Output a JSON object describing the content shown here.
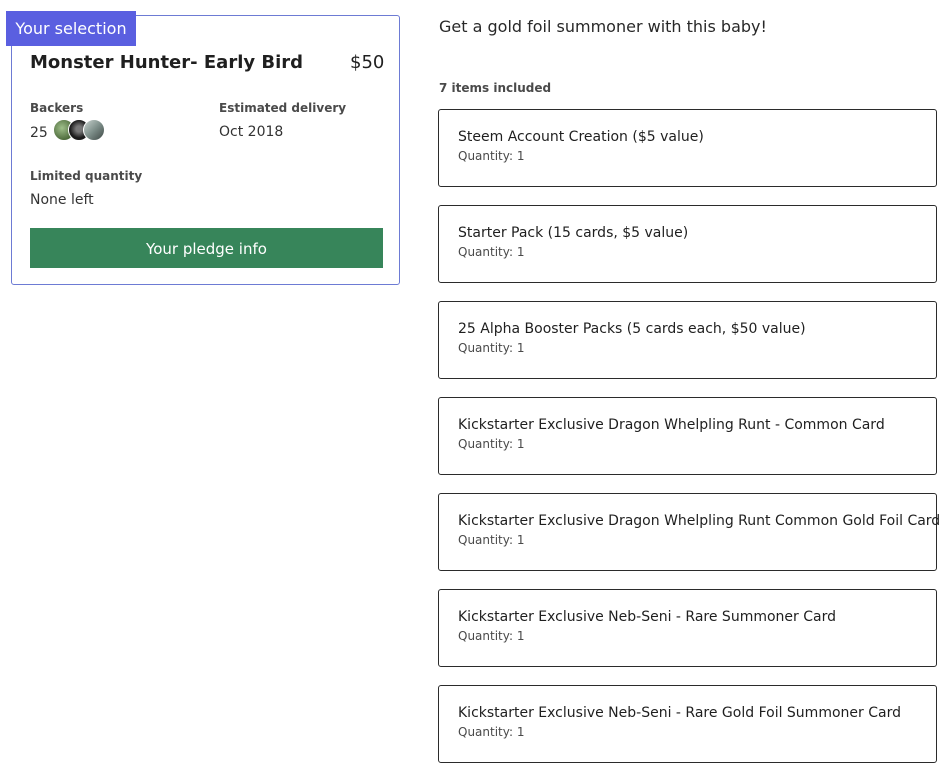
{
  "reward": {
    "badge": "Your selection",
    "title": "Monster Hunter- Early Bird",
    "price": "$50",
    "backers_label": "Backers",
    "backers_count": "25",
    "delivery_label": "Estimated delivery",
    "delivery_value": "Oct 2018",
    "limited_label": "Limited quantity",
    "limited_value": "None left",
    "pledge_button": "Your pledge info",
    "colors": {
      "accent": "#5a5fe0",
      "button": "#37855a",
      "border": "#6d7bd4"
    }
  },
  "details": {
    "description": "Get a gold foil summoner with this baby!",
    "items_count": "7 items included",
    "items": [
      {
        "name": "Steem Account Creation ($5 value)",
        "quantity": "Quantity: 1"
      },
      {
        "name": "Starter Pack (15 cards, $5 value)",
        "quantity": "Quantity: 1"
      },
      {
        "name": "25 Alpha Booster Packs (5 cards each, $50 value)",
        "quantity": "Quantity: 1"
      },
      {
        "name": "Kickstarter Exclusive Dragon Whelpling Runt - Common Card",
        "quantity": "Quantity: 1"
      },
      {
        "name": "Kickstarter Exclusive Dragon Whelpling Runt Common Gold Foil Card",
        "quantity": "Quantity: 1"
      },
      {
        "name": "Kickstarter Exclusive Neb-Seni - Rare Summoner Card",
        "quantity": "Quantity: 1"
      },
      {
        "name": "Kickstarter Exclusive Neb-Seni - Rare Gold Foil Summoner Card",
        "quantity": "Quantity: 1"
      }
    ]
  }
}
